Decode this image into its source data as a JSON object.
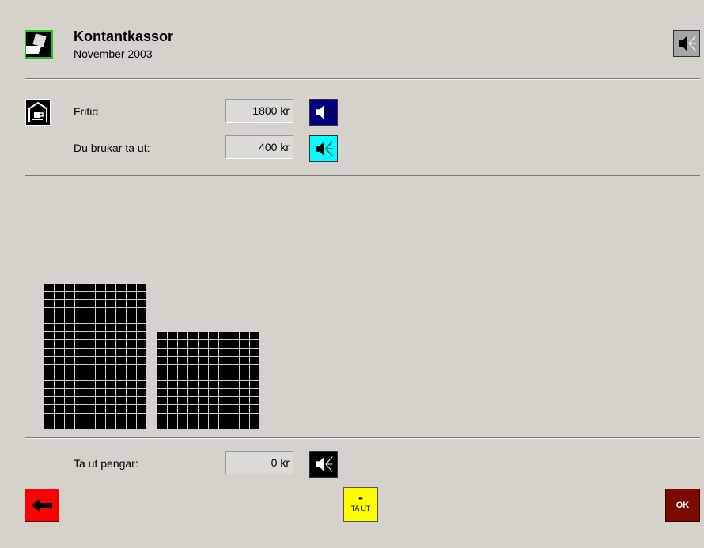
{
  "header": {
    "title": "Kontantkassor",
    "subtitle": "November 2003",
    "app_icon": "cash-register-icon",
    "speaker_icon": "speaker-icon"
  },
  "rows": {
    "fritid": {
      "label": "Fritid",
      "value": "1800",
      "unit": "kr",
      "speaker_color": "#00007f"
    },
    "du_brukar": {
      "label": "Du brukar ta ut:",
      "value": "400",
      "unit": "kr",
      "speaker_color": "#00ffff"
    },
    "ta_ut": {
      "label": "Ta ut pengar:",
      "value": "0",
      "unit": "kr",
      "speaker_color": "#000000"
    }
  },
  "category_icon": "coffee-cup-house-icon",
  "bars": [
    {
      "value": 1800
    },
    {
      "value": 1200
    }
  ],
  "buttons": {
    "back_icon": "arrow-left-icon",
    "taut_symbol": "-",
    "taut_label": "TA UT",
    "ok_label": "OK"
  },
  "colors": {
    "background": "#d5d1cb",
    "back": "#ff0000",
    "taut": "#ffff00",
    "ok": "#7b0a00"
  }
}
